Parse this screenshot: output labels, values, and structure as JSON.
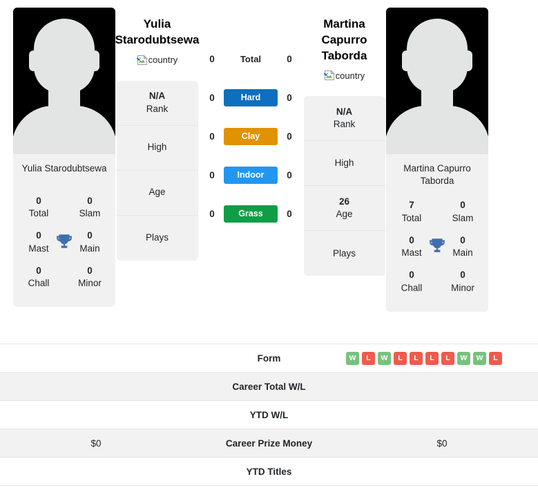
{
  "players": {
    "left": {
      "display_name": "Yulia Starodubtsewa",
      "name_line1": "Yulia",
      "name_line2": "Starodubtsewa",
      "country_alt": "country",
      "card_name": "Yulia Starodubtsewa",
      "titles": [
        {
          "num": "0",
          "label": "Total"
        },
        {
          "num": "0",
          "label": "Slam"
        },
        {
          "num": "0",
          "label": "Mast"
        },
        {
          "num": "0",
          "label": "Main"
        },
        {
          "num": "0",
          "label": "Chall"
        },
        {
          "num": "0",
          "label": "Minor"
        }
      ],
      "info": [
        {
          "value": "N/A",
          "label": "Rank"
        },
        {
          "value": "",
          "label": "High"
        },
        {
          "value": "",
          "label": "Age"
        },
        {
          "value": "",
          "label": "Plays"
        }
      ],
      "surface_wins": {
        "total": "0",
        "hard": "0",
        "clay": "0",
        "indoor": "0",
        "grass": "0"
      },
      "form": [],
      "career_total_wl": "",
      "ytd_wl": "",
      "career_prize_money": "$0",
      "ytd_titles": ""
    },
    "right": {
      "display_name": "Martina Capurro Taborda",
      "name_line1": "Martina",
      "name_line2": "Capurro",
      "name_line3": "Taborda",
      "country_alt": "country",
      "card_name": "Martina Capurro Taborda",
      "titles": [
        {
          "num": "7",
          "label": "Total"
        },
        {
          "num": "0",
          "label": "Slam"
        },
        {
          "num": "0",
          "label": "Mast"
        },
        {
          "num": "0",
          "label": "Main"
        },
        {
          "num": "0",
          "label": "Chall"
        },
        {
          "num": "0",
          "label": "Minor"
        }
      ],
      "info": [
        {
          "value": "N/A",
          "label": "Rank"
        },
        {
          "value": "",
          "label": "High"
        },
        {
          "value": "26",
          "label": "Age"
        },
        {
          "value": "",
          "label": "Plays"
        }
      ],
      "surface_wins": {
        "total": "0",
        "hard": "0",
        "clay": "0",
        "indoor": "0",
        "grass": "0"
      },
      "form": [
        "W",
        "L",
        "W",
        "L",
        "L",
        "L",
        "L",
        "W",
        "W",
        "L"
      ],
      "career_total_wl": "",
      "ytd_wl": "",
      "career_prize_money": "$0",
      "ytd_titles": ""
    }
  },
  "surfaces": [
    {
      "key": "total",
      "label": "Total",
      "color": ""
    },
    {
      "key": "hard",
      "label": "Hard",
      "color": "#0d6fbe"
    },
    {
      "key": "clay",
      "label": "Clay",
      "color": "#e09200"
    },
    {
      "key": "indoor",
      "label": "Indoor",
      "color": "#2196f3"
    },
    {
      "key": "grass",
      "label": "Grass",
      "color": "#0f9d46"
    }
  ],
  "table_rows": [
    {
      "label": "Form",
      "left": "",
      "right": ""
    },
    {
      "label": "Career Total W/L",
      "left": "",
      "right": ""
    },
    {
      "label": "YTD W/L",
      "left": "",
      "right": ""
    },
    {
      "label": "Career Prize Money",
      "left": "$0",
      "right": "$0"
    },
    {
      "label": "YTD Titles",
      "left": "",
      "right": ""
    }
  ],
  "colors": {
    "hard": "#0d6fbe",
    "clay": "#e09200",
    "indoor": "#2196f3",
    "grass": "#0f9d46",
    "win_badge": "#78c27c",
    "loss_badge": "#ef5b4c",
    "trophy": "#3f6fb0",
    "card_bg": "#f1f1f1"
  }
}
